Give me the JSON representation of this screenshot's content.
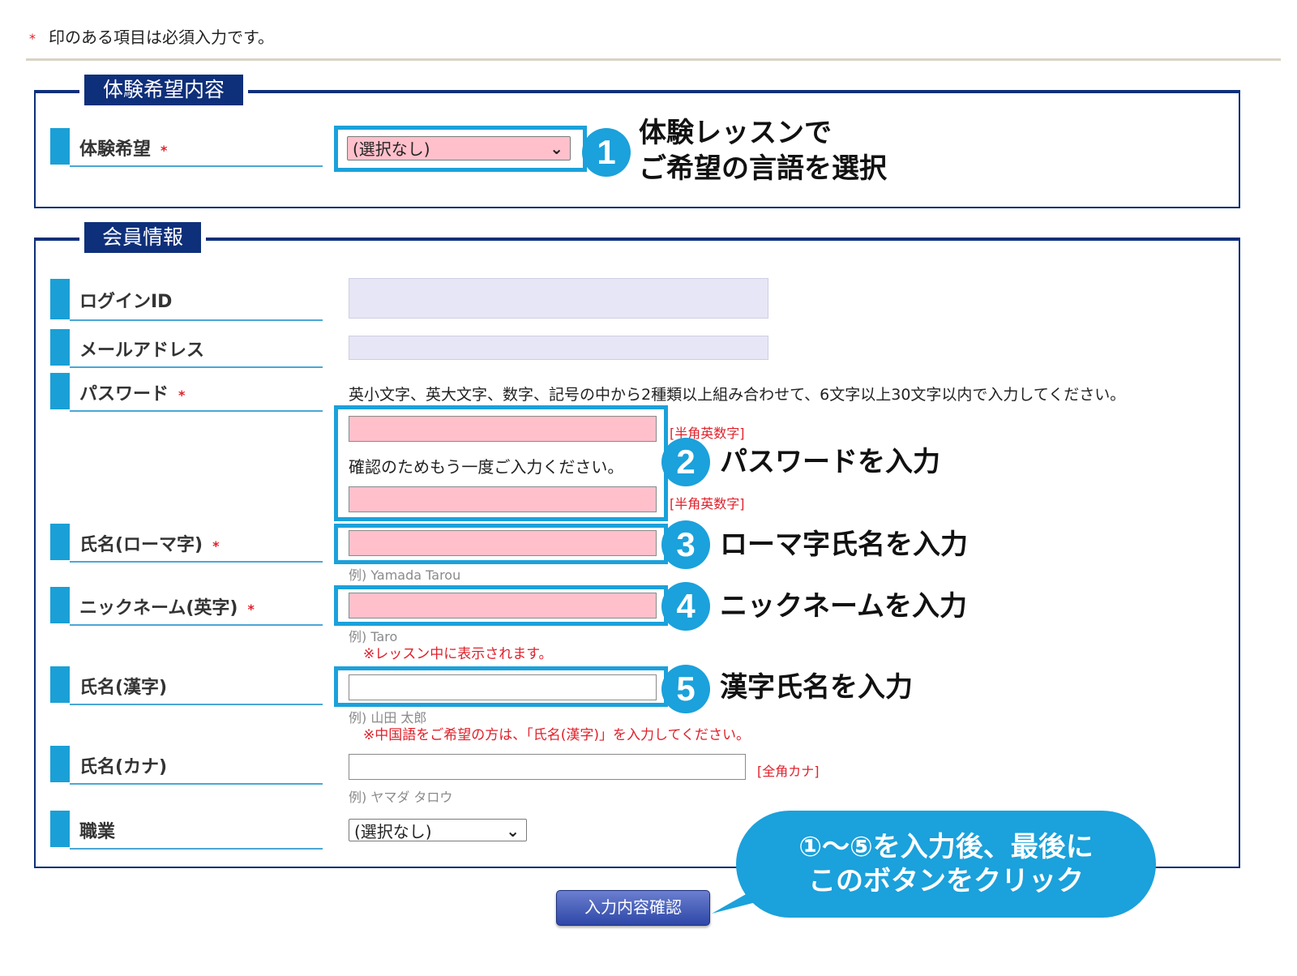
{
  "required_note": {
    "mark": "*",
    "text": "印のある項目は必須入力です。"
  },
  "sections": {
    "trial": {
      "legend": "体験希望内容",
      "label": "体験希望"
    },
    "member": {
      "legend": "会員情報"
    }
  },
  "trial_select": {
    "value": "(選択なし)"
  },
  "fields": {
    "login_id": {
      "label": "ログインID"
    },
    "email": {
      "label": "メールアドレス"
    },
    "password": {
      "label": "パスワード",
      "instructions": "英小文字、英大文字、数字、記号の中から2種類以上組み合わせて、6文字以上30文字以内で入力してください。",
      "type_tag": "[半角英数字]",
      "confirm_text": "確認のためもう一度ご入力ください。",
      "confirm_tag": "[半角英数字]"
    },
    "name_roman": {
      "label": "氏名(ローマ字)",
      "example": "例) Yamada Tarou"
    },
    "nickname": {
      "label": "ニックネーム(英字)",
      "example": "例) Taro",
      "note": "※レッスン中に表示されます。"
    },
    "name_kanji": {
      "label": "氏名(漢字)",
      "example": "例) 山田 太郎",
      "note": "※中国語をご希望の方は、「氏名(漢字)」を入力してください。"
    },
    "name_kana": {
      "label": "氏名(カナ)",
      "tag": "[全角カナ]",
      "example": "例) ヤマダ タロウ"
    },
    "occupation": {
      "label": "職業",
      "value": "(選択なし)"
    }
  },
  "annotations": {
    "step1": {
      "num": "1",
      "line1": "体験レッスンで",
      "line2": "ご希望の言語を選択"
    },
    "step2": {
      "num": "2",
      "text": "パスワードを入力"
    },
    "step3": {
      "num": "3",
      "text": "ローマ字氏名を入力"
    },
    "step4": {
      "num": "4",
      "text": "ニックネームを入力"
    },
    "step5": {
      "num": "5",
      "text": "漢字氏名を入力"
    },
    "bubble": {
      "line1": "①〜⑤を入力後、最後に",
      "line2": "このボタンをクリック"
    }
  },
  "confirm_button": {
    "label": "入力内容確認"
  },
  "colors": {
    "navy": "#0e2f7a",
    "accent_blue": "#1ba1db",
    "required_pink": "#ffc0cb",
    "readonly_lavender": "#e6e6f6",
    "required_red": "#e0202a"
  }
}
